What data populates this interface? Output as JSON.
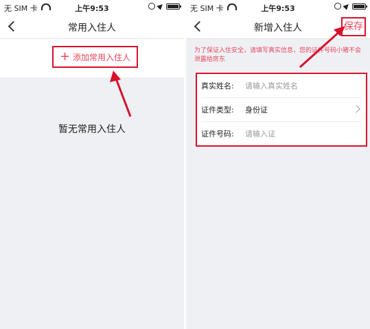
{
  "status_bar": {
    "carrier": "无 SIM 卡",
    "time": "上午9:53"
  },
  "left_screen": {
    "title": "常用入住人",
    "add_button_label": "添加常用入住人",
    "empty_message": "暂无常用入住人"
  },
  "right_screen": {
    "title": "新增入住人",
    "save_label": "保存",
    "notice": "为了保证入住安全，请填写真实信息，您的证件号码小猪不会泄露给房东",
    "form": {
      "name_label": "真实姓名:",
      "name_placeholder": "请输入真实姓名",
      "id_type_label": "证件类型:",
      "id_type_value": "身份证",
      "id_number_label": "证件号码:",
      "id_number_placeholder": "请输入证"
    }
  },
  "colors": {
    "accent": "#e8465d",
    "annotation_red": "#d90f2a",
    "background": "#eef0f3"
  },
  "icons": [
    "back-icon",
    "plus-icon",
    "chevron-right-icon",
    "wifi-icon",
    "battery-icon",
    "location-icon",
    "rotation-lock-icon"
  ]
}
